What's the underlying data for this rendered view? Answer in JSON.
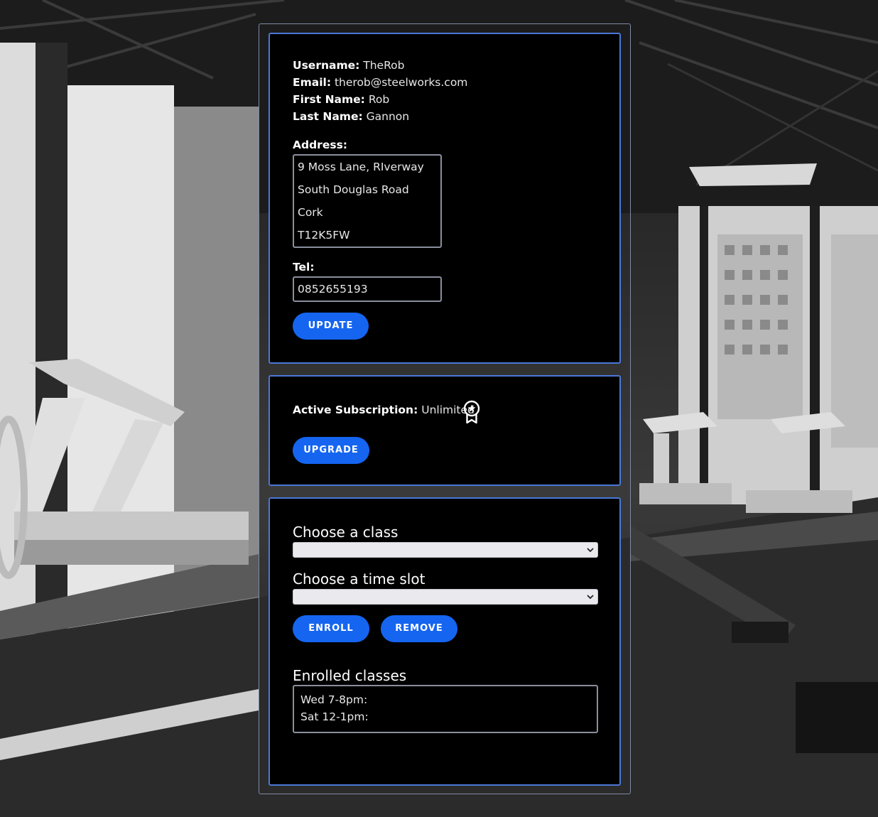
{
  "profile": {
    "username_label": "Username:",
    "username": "TheRob",
    "email_label": "Email:",
    "email": "therob@steelworks.com",
    "first_name_label": "First Name:",
    "first_name": "Rob",
    "last_name_label": "Last Name:",
    "last_name": "Gannon",
    "address_label": "Address:",
    "address_lines": [
      "9 Moss Lane, RIverway",
      "South Douglas Road",
      "Cork",
      "T12K5FW"
    ],
    "tel_label": "Tel:",
    "tel": "0852655193",
    "update_button": "UPDATE"
  },
  "subscription": {
    "label": "Active Subscription:",
    "value": "Unlimited",
    "badge_icon": "award-ribbon-icon",
    "upgrade_button": "UPGRADE"
  },
  "classes": {
    "choose_class_label": "Choose a class",
    "class_selected": "",
    "choose_time_label": "Choose a time slot",
    "time_selected": "",
    "enroll_button": "ENROLL",
    "remove_button": "REMOVE",
    "enrolled_label": "Enrolled classes",
    "enrolled": [
      "Wed 7-8pm:",
      "Sat 12-1pm:"
    ]
  },
  "colors": {
    "accent": "#1565f0",
    "card_border": "#4a78d8",
    "card_bg": "#000000"
  }
}
